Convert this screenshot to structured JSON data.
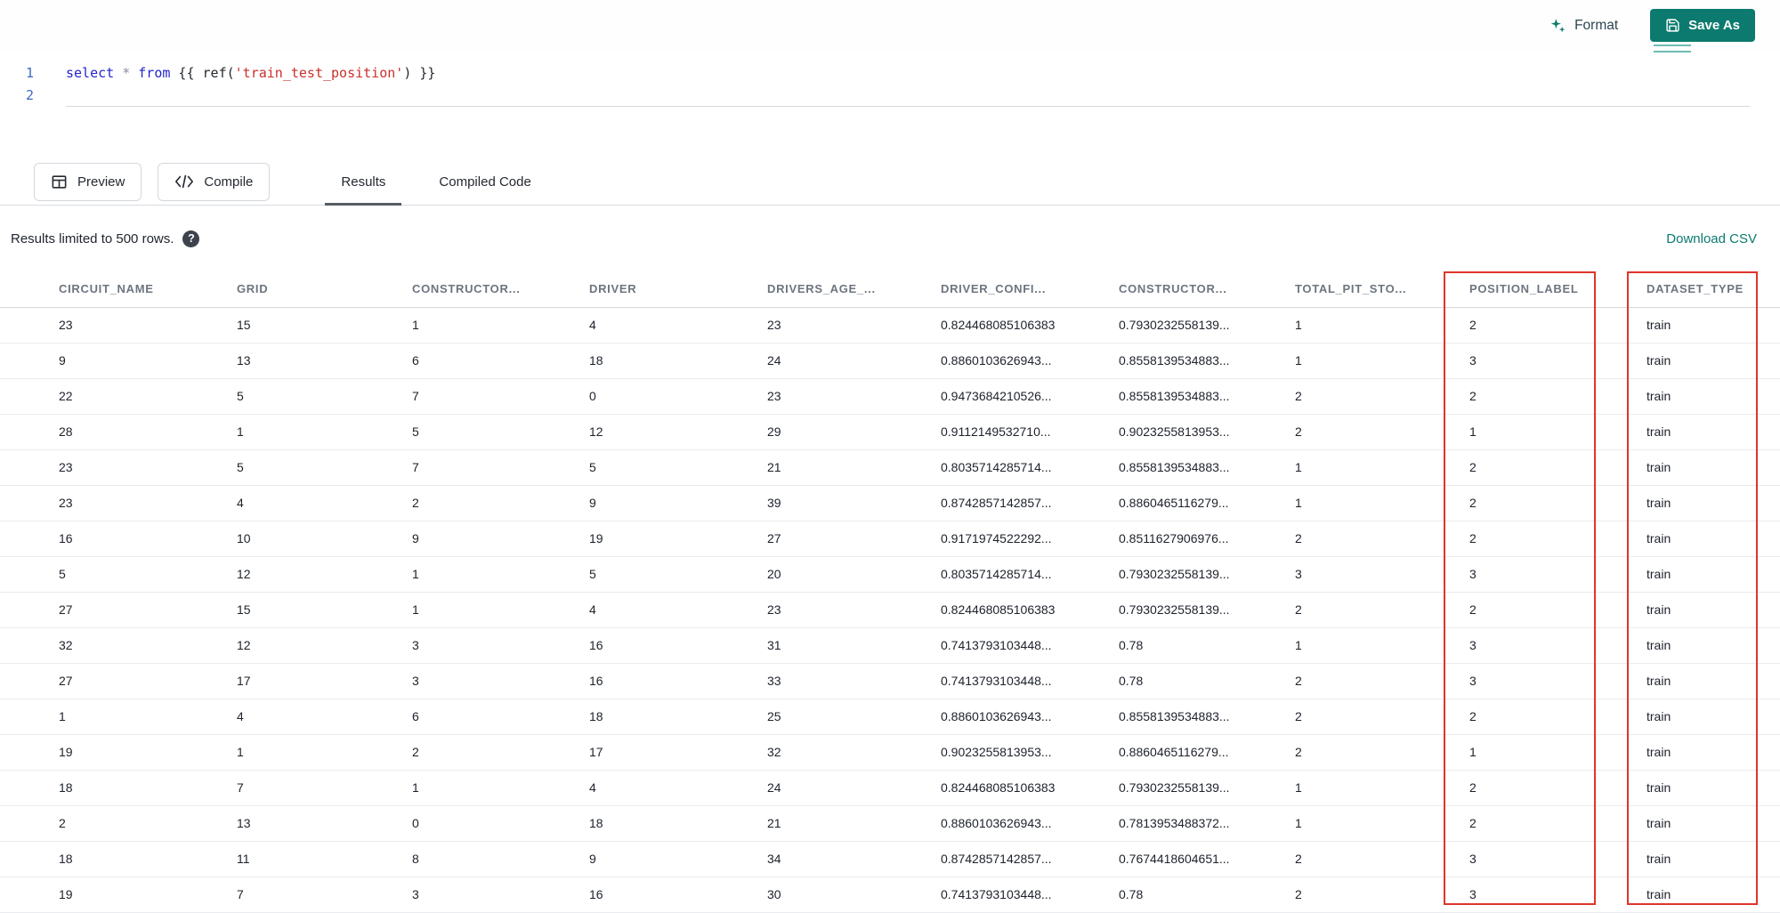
{
  "toolbar": {
    "format_label": "Format",
    "save_as_label": "Save As",
    "accent_color": "#0c7a6e"
  },
  "editor": {
    "lines": [
      {
        "number": "1",
        "underline": false,
        "tokens": [
          {
            "type": "keyword",
            "text": "select"
          },
          {
            "type": "plain",
            "text": " "
          },
          {
            "type": "operator",
            "text": "*"
          },
          {
            "type": "plain",
            "text": " "
          },
          {
            "type": "keyword",
            "text": "from"
          },
          {
            "type": "plain",
            "text": " {{ ref("
          },
          {
            "type": "string",
            "text": "'train_test_position'"
          },
          {
            "type": "plain",
            "text": ") }}"
          }
        ]
      },
      {
        "number": "2",
        "underline": true,
        "tokens": []
      }
    ]
  },
  "actions": {
    "preview_label": "Preview",
    "compile_label": "Compile",
    "tabs": [
      {
        "label": "Results",
        "active": true
      },
      {
        "label": "Compiled Code",
        "active": false
      }
    ]
  },
  "results": {
    "limit_notice": "Results limited to 500 rows.",
    "help_glyph": "?",
    "download_csv_label": "Download CSV"
  },
  "table": {
    "headers": [
      "CIRCUIT_NAME",
      "GRID",
      "CONSTRUCTOR...",
      "DRIVER",
      "DRIVERS_AGE_...",
      "DRIVER_CONFI...",
      "CONSTRUCTOR...",
      "TOTAL_PIT_STO...",
      "POSITION_LABEL",
      "DATASET_TYPE"
    ],
    "rows": [
      [
        "23",
        "15",
        "1",
        "4",
        "23",
        "0.824468085106383",
        "0.7930232558139...",
        "1",
        "2",
        "train"
      ],
      [
        "9",
        "13",
        "6",
        "18",
        "24",
        "0.8860103626943...",
        "0.8558139534883...",
        "1",
        "3",
        "train"
      ],
      [
        "22",
        "5",
        "7",
        "0",
        "23",
        "0.9473684210526...",
        "0.8558139534883...",
        "2",
        "2",
        "train"
      ],
      [
        "28",
        "1",
        "5",
        "12",
        "29",
        "0.9112149532710...",
        "0.9023255813953...",
        "2",
        "1",
        "train"
      ],
      [
        "23",
        "5",
        "7",
        "5",
        "21",
        "0.8035714285714...",
        "0.8558139534883...",
        "1",
        "2",
        "train"
      ],
      [
        "23",
        "4",
        "2",
        "9",
        "39",
        "0.8742857142857...",
        "0.8860465116279...",
        "1",
        "2",
        "train"
      ],
      [
        "16",
        "10",
        "9",
        "19",
        "27",
        "0.9171974522292...",
        "0.8511627906976...",
        "2",
        "2",
        "train"
      ],
      [
        "5",
        "12",
        "1",
        "5",
        "20",
        "0.8035714285714...",
        "0.7930232558139...",
        "3",
        "3",
        "train"
      ],
      [
        "27",
        "15",
        "1",
        "4",
        "23",
        "0.824468085106383",
        "0.7930232558139...",
        "2",
        "2",
        "train"
      ],
      [
        "32",
        "12",
        "3",
        "16",
        "31",
        "0.7413793103448...",
        "0.78",
        "1",
        "3",
        "train"
      ],
      [
        "27",
        "17",
        "3",
        "16",
        "33",
        "0.7413793103448...",
        "0.78",
        "2",
        "3",
        "train"
      ],
      [
        "1",
        "4",
        "6",
        "18",
        "25",
        "0.8860103626943...",
        "0.8558139534883...",
        "2",
        "2",
        "train"
      ],
      [
        "19",
        "1",
        "2",
        "17",
        "32",
        "0.9023255813953...",
        "0.8860465116279...",
        "2",
        "1",
        "train"
      ],
      [
        "18",
        "7",
        "1",
        "4",
        "24",
        "0.824468085106383",
        "0.7930232558139...",
        "1",
        "2",
        "train"
      ],
      [
        "2",
        "13",
        "0",
        "18",
        "21",
        "0.8860103626943...",
        "0.7813953488372...",
        "1",
        "2",
        "train"
      ],
      [
        "18",
        "11",
        "8",
        "9",
        "34",
        "0.8742857142857...",
        "0.7674418604651...",
        "2",
        "3",
        "train"
      ],
      [
        "19",
        "7",
        "3",
        "16",
        "30",
        "0.7413793103448...",
        "0.78",
        "2",
        "3",
        "train"
      ]
    ],
    "highlight": {
      "color": "#e0352b",
      "columns": [
        "POSITION_LABEL",
        "DATASET_TYPE"
      ]
    }
  }
}
